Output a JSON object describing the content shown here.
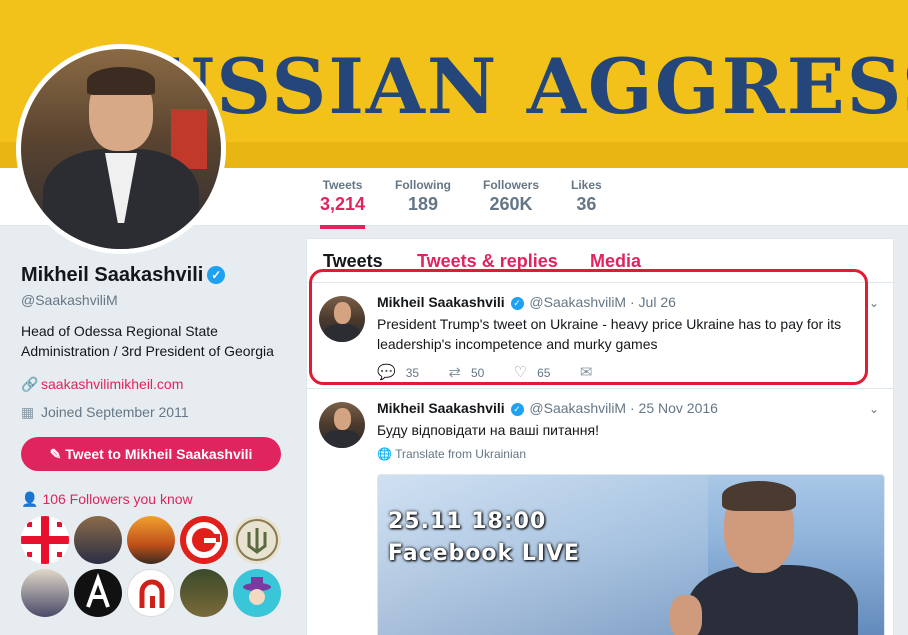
{
  "banner": {
    "text": "USSIAN AGGRESS"
  },
  "nav": {
    "stats": [
      {
        "label": "Tweets",
        "value": "3,214"
      },
      {
        "label": "Following",
        "value": "189"
      },
      {
        "label": "Followers",
        "value": "260K"
      },
      {
        "label": "Likes",
        "value": "36"
      }
    ]
  },
  "profile": {
    "name": "Mikheil Saakashvili",
    "handle": "@SaakashviliM",
    "bio": "Head of Odessa Regional State Administration / 3rd President of Georgia",
    "website": "saakashvilimikheil.com",
    "joined": "Joined September 2011",
    "tweet_to": "Tweet to Mikheil Saakashvili",
    "followers_you_know": "106 Followers you know",
    "verified_icon": "verified-badge-icon"
  },
  "timeline": {
    "tabs": [
      "Tweets",
      "Tweets & replies",
      "Media"
    ],
    "tweets": [
      {
        "name": "Mikheil Saakashvili",
        "handle": "@SaakashviliM",
        "time": "Jul 26",
        "text": "President Trump's tweet on Ukraine - heavy price Ukraine has to pay for its leadership's incompetence and murky games",
        "replies": "35",
        "retweets": "50",
        "likes": "65"
      },
      {
        "name": "Mikheil Saakashvili",
        "handle": "@SaakashviliM",
        "time": "25 Nov 2016",
        "text": "Буду відповідати на ваші питання!",
        "translate": "Translate from Ukrainian",
        "media_line1": "25.11    18:00",
        "media_line2": "Facebook LIVE"
      }
    ]
  },
  "colors": {
    "accent": "#e0245e",
    "verified": "#1da1f2",
    "highlight": "#e21b32",
    "banner": "#f2c21a"
  }
}
